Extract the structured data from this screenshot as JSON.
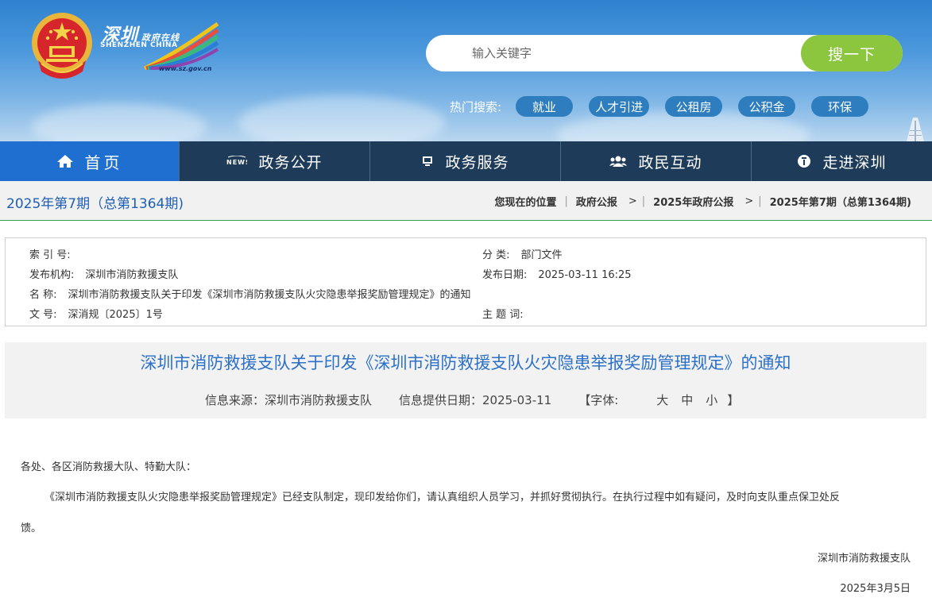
{
  "header": {
    "logo": {
      "cn": "深圳",
      "cn_small": "政府在线",
      "en": "SHENZHEN  CHINA",
      "url": "www.sz.gov.cn"
    },
    "search": {
      "placeholder": "输入关键字",
      "button": "搜一下"
    },
    "hot_search": {
      "label": "热门搜索:",
      "tags": [
        "就业",
        "人才引进",
        "公租房",
        "公积金",
        "环保"
      ]
    }
  },
  "nav": {
    "items": [
      {
        "label": "首页",
        "icon": "home-icon"
      },
      {
        "label": "政务公开",
        "icon": "news-icon"
      },
      {
        "label": "政务服务",
        "icon": "monitor-icon"
      },
      {
        "label": "政民互动",
        "icon": "people-icon"
      },
      {
        "label": "走进深圳",
        "icon": "info-icon"
      }
    ]
  },
  "issue": {
    "title": "2025年第7期（总第1364期)",
    "breadcrumb": {
      "location_label": "您现在的位置",
      "items": [
        "政府公报",
        "2025年政府公报",
        "2025年第7期（总第1364期)"
      ]
    }
  },
  "meta": {
    "index_no": {
      "label": "索 引 号:",
      "value": ""
    },
    "category": {
      "label": "分  类:",
      "value": "部门文件"
    },
    "publisher": {
      "label": "发布机构:",
      "value": "深圳市消防救援支队"
    },
    "publish_date": {
      "label": "发布日期:",
      "value": "2025-03-11 16:25"
    },
    "name": {
      "label": "名  称:",
      "value": "深圳市消防救援支队关于印发《深圳市消防救援支队火灾隐患举报奖励管理规定》的通知"
    },
    "doc_no": {
      "label": "文  号:",
      "value": "深消规〔2025〕1号"
    },
    "keywords": {
      "label": "主 题 词:",
      "value": ""
    }
  },
  "article": {
    "title": "深圳市消防救援支队关于印发《深圳市消防救援支队火灾隐患举报奖励管理规定》的通知",
    "source": "信息来源：深圳市消防救援支队",
    "date": "信息提供日期：2025-03-11",
    "font_label": "【字体:",
    "font_options": [
      "大",
      "中",
      "小"
    ],
    "font_close": "】",
    "salutation": "各处、各区消防救援大队、特勤大队：",
    "para1_line1": "《深圳市消防救援支队火灾隐患举报奖励管理规定》已经支队制定，现印发给你们，请认真组织人员学习，并抓好贯彻执行。在执行过程中如有疑问，及时向支队重点保卫处反",
    "para1_line2": "馈。",
    "signature": "深圳市消防救援支队",
    "sign_date": "2025年3月5日"
  }
}
